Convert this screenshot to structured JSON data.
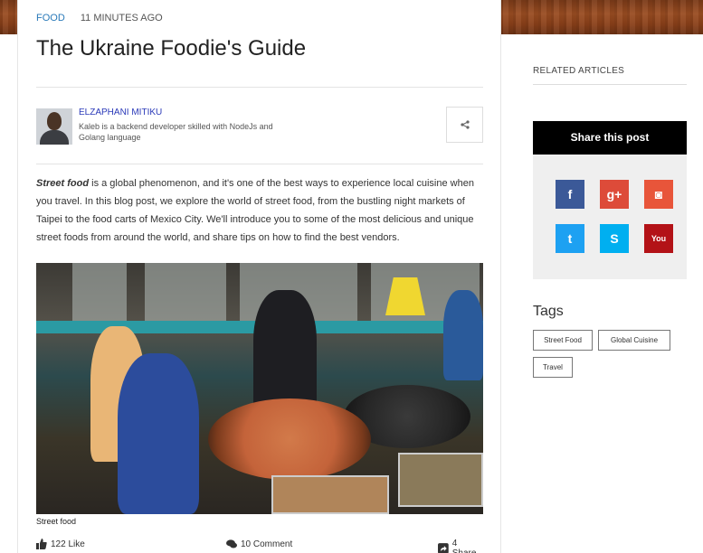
{
  "article": {
    "category": "FOOD",
    "time": "11 MINUTES AGO",
    "title": "The Ukraine Foodie's Guide",
    "author": {
      "name": "ELZAPHANI MITIKU",
      "bio": "Kaleb is a backend developer skilled with NodeJs and Golang language"
    },
    "intro_lead": "Street food",
    "intro_rest": " is a global phenomenon, and it's one of the best ways to experience local cuisine when you travel. In this blog post, we explore the world of street food, from the bustling night markets of Taipei to the food carts of Mexico City. We'll introduce you to some of the most delicious and unique street foods from around the world, and share tips on how to find the best vendors.",
    "image_caption": "Street food",
    "stats": {
      "likes": "122 Like",
      "comments": "10 Comment",
      "shares": "4 Share"
    }
  },
  "sidebar": {
    "related_title": "RELATED ARTICLES",
    "share_title": "Share this post",
    "social": [
      {
        "name": "facebook",
        "glyph": "f",
        "color": "#3b5998"
      },
      {
        "name": "google-plus",
        "glyph": "g+",
        "color": "#dd4b39"
      },
      {
        "name": "instagram",
        "glyph": "◙",
        "color": "#e8553a"
      },
      {
        "name": "twitter",
        "glyph": "t",
        "color": "#1da1f2"
      },
      {
        "name": "skype",
        "glyph": "S",
        "color": "#00aff0"
      },
      {
        "name": "youtube",
        "glyph": "You",
        "color": "#b31217"
      }
    ],
    "tags_title": "Tags",
    "tags": [
      "Street Food",
      "Global Cuisine",
      "Travel"
    ]
  }
}
